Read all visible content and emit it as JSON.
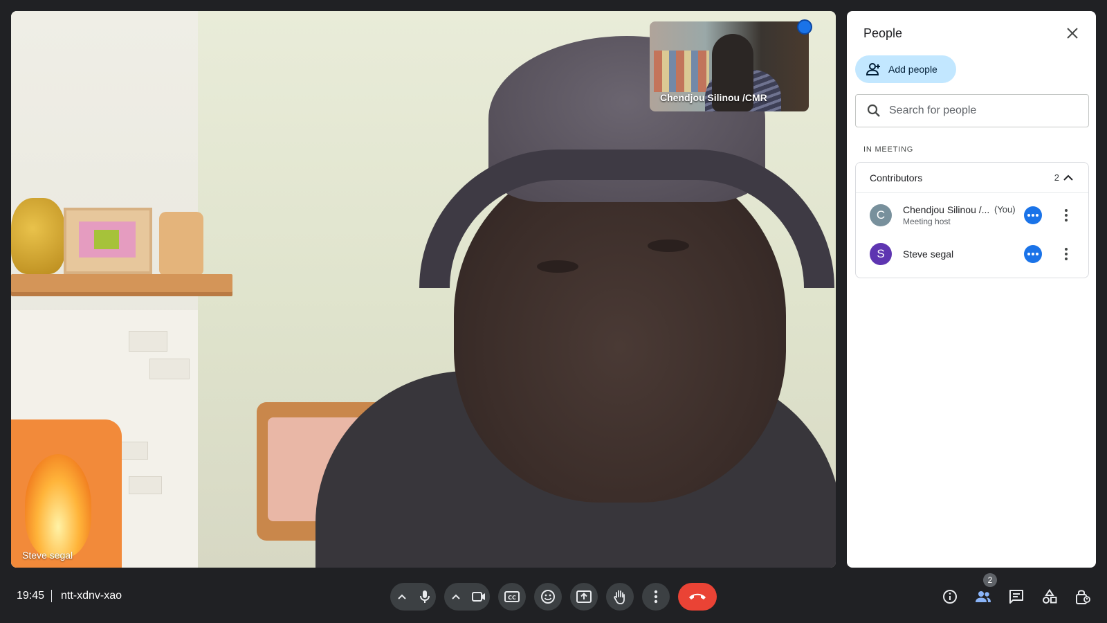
{
  "main_video": {
    "participant_label": "Steve segal"
  },
  "self_view": {
    "participant_label": "Chendjou Silinou /CMR"
  },
  "people_panel": {
    "title": "People",
    "add_people_label": "Add people",
    "search_placeholder": "Search for people",
    "section_label": "IN MEETING",
    "group": {
      "label": "Contributors",
      "count": "2"
    },
    "participants": [
      {
        "initial": "C",
        "name": "Chendjou Silinou /...",
        "subtitle": "Meeting host",
        "you_tag": "(You)",
        "avatar_color": "#78909c"
      },
      {
        "initial": "S",
        "name": "Steve segal",
        "subtitle": "",
        "you_tag": "",
        "avatar_color": "#5e35b1"
      }
    ]
  },
  "bottom_bar": {
    "time": "19:45",
    "meeting_code": "ntt-xdnv-xao",
    "people_badge_count": "2",
    "controls": [
      "audio-options-chevron",
      "microphone",
      "video-options-chevron",
      "camera",
      "captions",
      "emoji-reactions",
      "present-screen",
      "raise-hand",
      "more-options",
      "leave-call"
    ],
    "right_icons": [
      "meeting-details",
      "people",
      "chat",
      "activities",
      "host-controls"
    ]
  },
  "colors": {
    "background": "#202124",
    "control_bg": "#3c4043",
    "end_call": "#ea4335",
    "accent_blue": "#1a73e8",
    "add_people_bg": "#c2e7ff",
    "people_icon_active": "#8ab4f8"
  }
}
